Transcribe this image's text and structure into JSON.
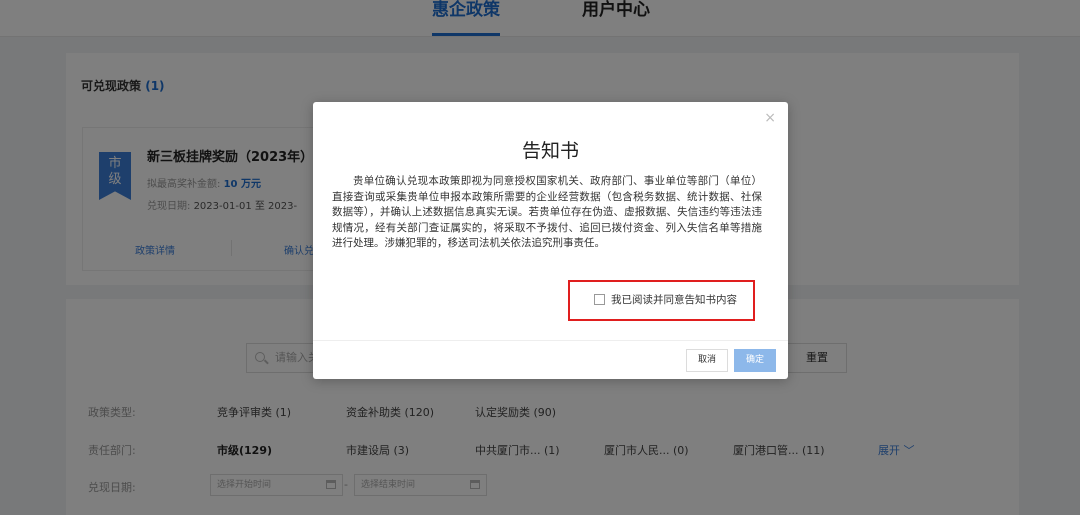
{
  "header": {
    "tabs": [
      {
        "label": "惠企政策",
        "active": true
      },
      {
        "label": "用户中心",
        "active": false
      }
    ]
  },
  "redeemable": {
    "title": "可兑现政策",
    "count": "(1)",
    "card": {
      "level_chars": [
        "市",
        "级"
      ],
      "title": "新三板挂牌奖励（2023年）",
      "max_amount_label": "拟最高奖补金额:",
      "max_amount_value": "10 万元",
      "date_label": "兑现日期:",
      "date_value": "2023-01-01 至 2023-",
      "detail_link": "政策详情",
      "confirm_link": "确认兑"
    }
  },
  "search": {
    "placeholder": "请输入关",
    "reset_label": "重置"
  },
  "filters": {
    "policy_type": {
      "label": "政策类型:",
      "options": [
        "竞争评审类 (1)",
        "资金补助类 (120)",
        "认定奖励类 (90)"
      ]
    },
    "department": {
      "label": "责任部门:",
      "options": [
        "市级(129)",
        "市建设局 (3)",
        "中共厦门市... (1)",
        "厦门市人民... (0)",
        "厦门港口管... (11)"
      ],
      "expand_label": "展开"
    },
    "date": {
      "label": "兑现日期:",
      "start_placeholder": "选择开始时间",
      "end_placeholder": "选择结束时间",
      "separator": "-"
    }
  },
  "modal": {
    "close_glyph": "×",
    "title": "告知书",
    "body": "贵单位确认兑现本政策即视为同意授权国家机关、政府部门、事业单位等部门（单位）直接查询或采集贵单位申报本政策所需要的企业经营数据（包含税务数据、统计数据、社保数据等），并确认上述数据信息真实无误。若贵单位存在伪造、虚报数据、失信违约等违法违规情况，经有关部门查证属实的，将采取不予拨付、追回已拨付资金、列入失信名单等措施进行处理。涉嫌犯罪的，移送司法机关依法追究刑事责任。",
    "agree_label": "我已阅读并同意告知书内容",
    "cancel_label": "取消",
    "confirm_label": "确定"
  },
  "colors": {
    "primary": "#1f6fd1",
    "highlight_border": "#e01e1e",
    "confirm_disabled": "#8db8ea"
  }
}
